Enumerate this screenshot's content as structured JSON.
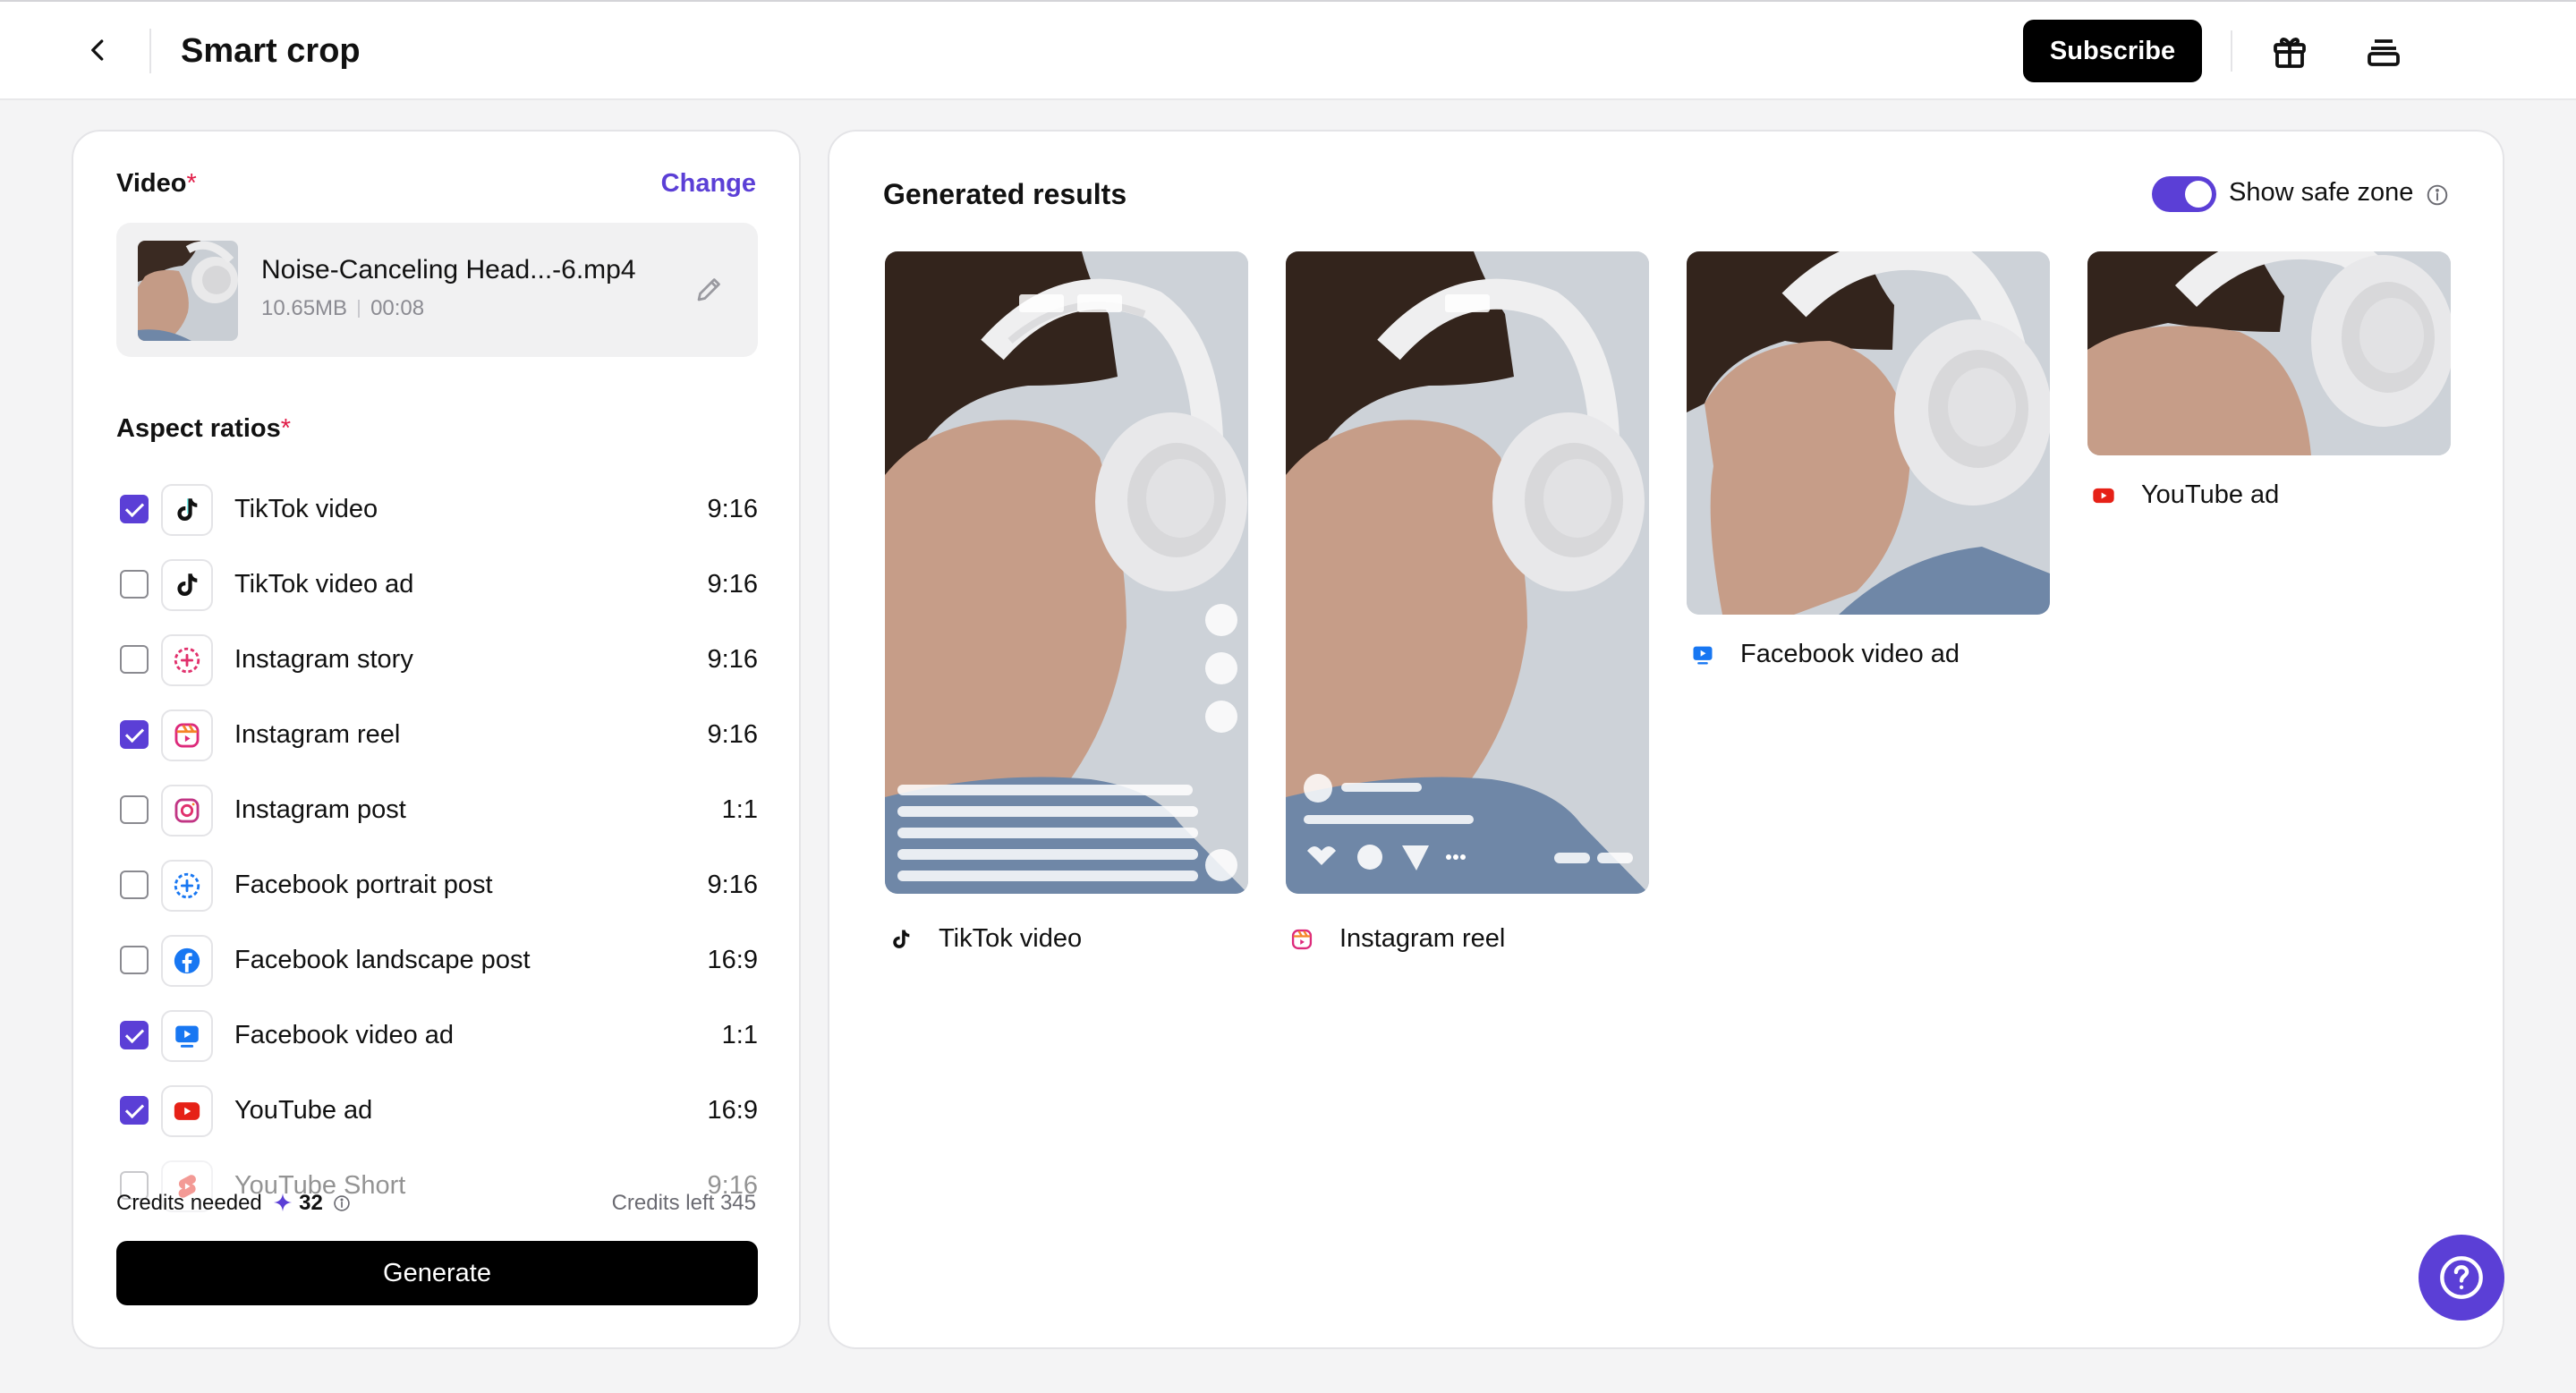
{
  "header": {
    "title": "Smart crop",
    "subscribe_label": "Subscribe"
  },
  "left": {
    "video_label": "Video",
    "required_mark": "*",
    "change_label": "Change",
    "file": {
      "name": "Noise-Canceling Head...-6.mp4",
      "size": "10.65MB",
      "duration": "00:08"
    },
    "aspect_label": "Aspect ratios",
    "platforms": [
      {
        "name": "TikTok video",
        "ratio": "9:16",
        "checked": true,
        "icon": "tiktok-icon"
      },
      {
        "name": "TikTok video ad",
        "ratio": "9:16",
        "checked": false,
        "icon": "tiktok-icon"
      },
      {
        "name": "Instagram story",
        "ratio": "9:16",
        "checked": false,
        "icon": "instagram-story-icon"
      },
      {
        "name": "Instagram reel",
        "ratio": "9:16",
        "checked": true,
        "icon": "instagram-reel-icon"
      },
      {
        "name": "Instagram post",
        "ratio": "1:1",
        "checked": false,
        "icon": "instagram-icon"
      },
      {
        "name": "Facebook portrait post",
        "ratio": "9:16",
        "checked": false,
        "icon": "facebook-story-icon"
      },
      {
        "name": "Facebook landscape post",
        "ratio": "16:9",
        "checked": false,
        "icon": "facebook-icon"
      },
      {
        "name": "Facebook video ad",
        "ratio": "1:1",
        "checked": true,
        "icon": "facebook-video-icon"
      },
      {
        "name": "YouTube ad",
        "ratio": "16:9",
        "checked": true,
        "icon": "youtube-icon"
      },
      {
        "name": "YouTube Short",
        "ratio": "9:16",
        "checked": false,
        "icon": "youtube-shorts-icon"
      }
    ],
    "credits_needed_label": "Credits needed",
    "credits_needed_value": "32",
    "credits_left": "Credits left 345",
    "generate_label": "Generate"
  },
  "right": {
    "title": "Generated results",
    "safe_zone_label": "Show safe zone",
    "results": [
      {
        "caption": "TikTok video",
        "icon": "tiktok-icon"
      },
      {
        "caption": "Instagram reel",
        "icon": "instagram-reel-icon"
      },
      {
        "caption": "Facebook video ad",
        "icon": "facebook-video-icon"
      },
      {
        "caption": "YouTube ad",
        "icon": "youtube-icon"
      }
    ]
  },
  "colors": {
    "accent": "#5b3fd6",
    "youtube": "#e62117",
    "facebook": "#1877f2"
  }
}
